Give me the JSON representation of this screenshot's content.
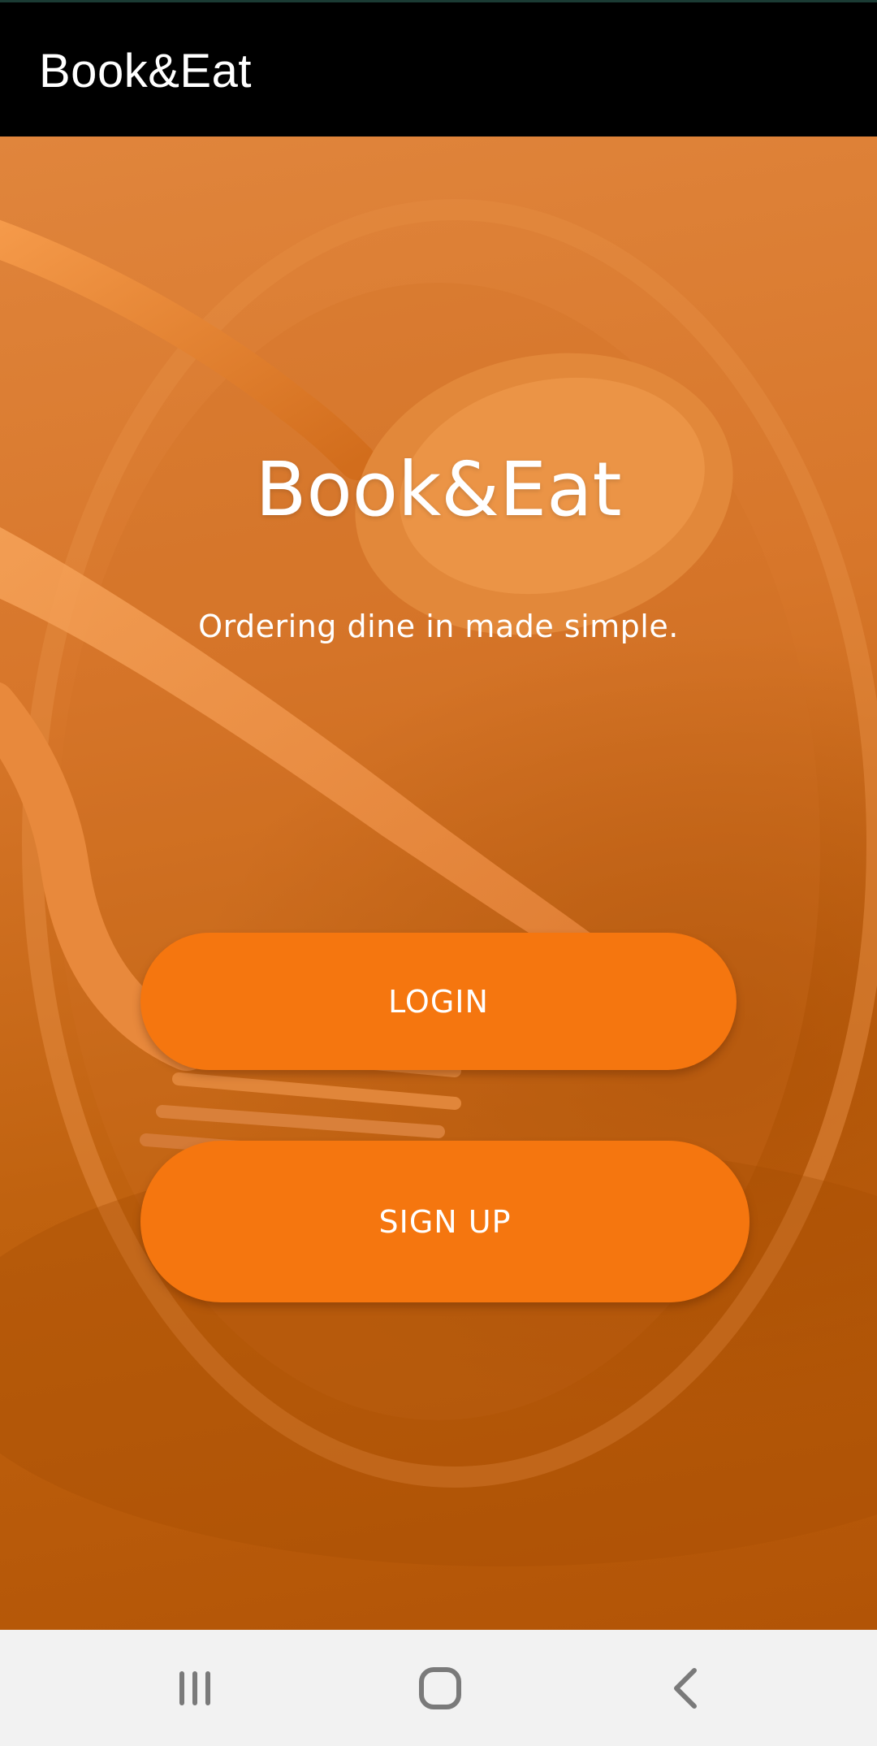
{
  "app_bar": {
    "title": "Book&Eat",
    "background_color": "#000000"
  },
  "hero": {
    "title": "Book&Eat",
    "subtitle": "Ordering dine in made simple.",
    "background_color": "#c96a1c",
    "background_image": "cutlery-plate-photo"
  },
  "actions": {
    "login_label": "LOGIN",
    "signup_label": "SIGN UP",
    "button_color": "#f5760f"
  },
  "navigation_bar": {
    "recents_icon": "recent-apps-icon",
    "home_icon": "home-icon",
    "back_icon": "back-icon"
  }
}
